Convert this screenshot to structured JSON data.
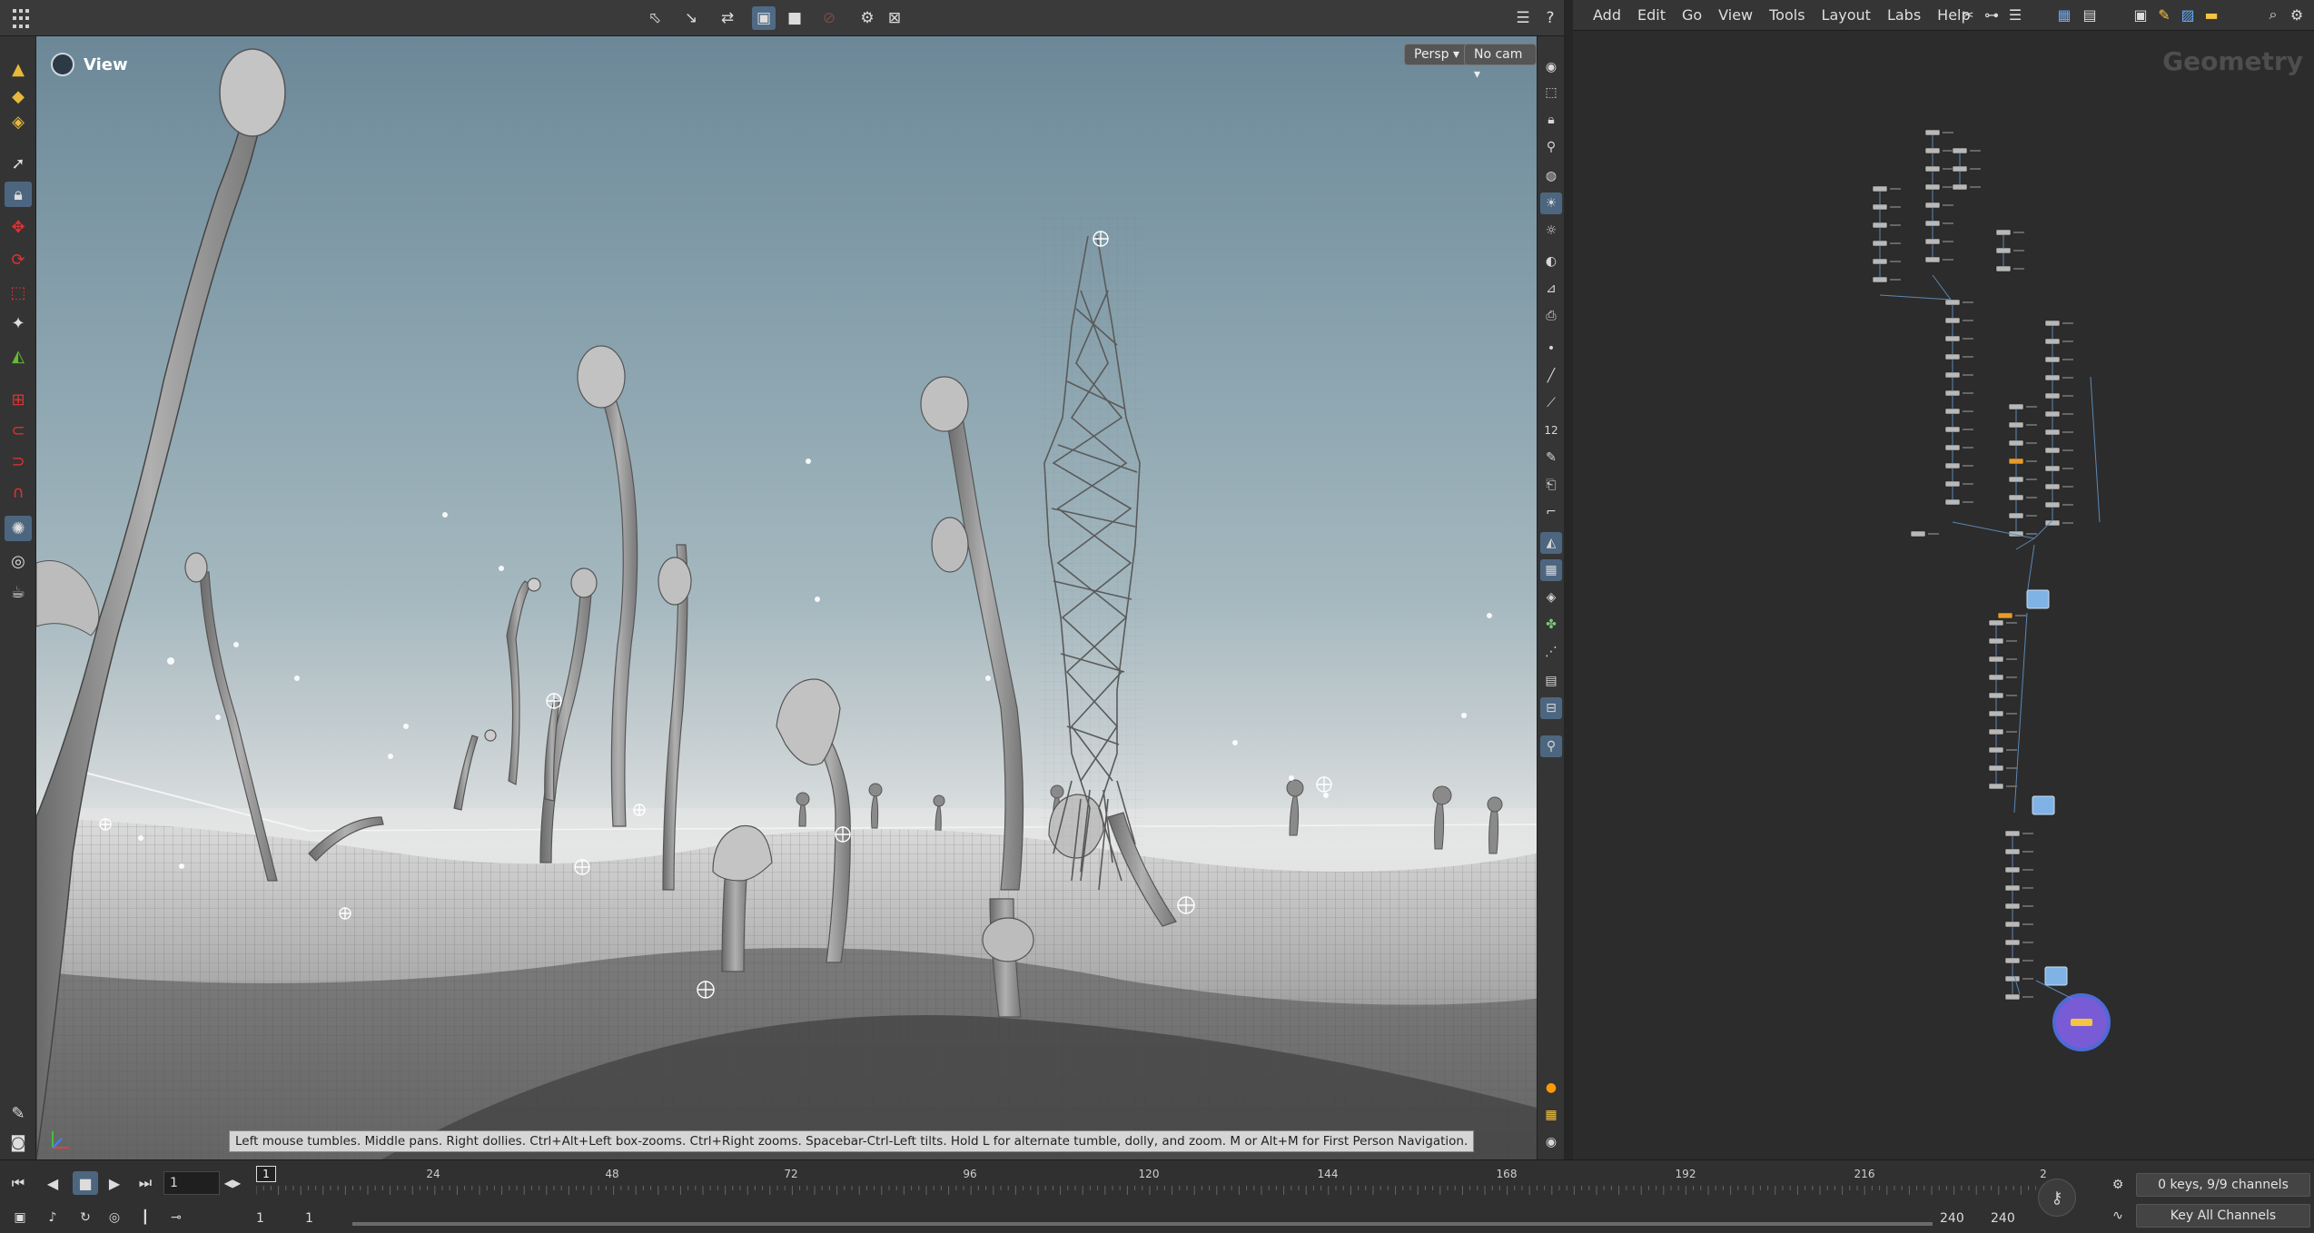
{
  "viewer": {
    "title": "View",
    "persp_label": "Persp ▾",
    "cam_label": "No cam ▾",
    "hint": "Left mouse tumbles. Middle pans. Right dollies. Ctrl+Alt+Left box-zooms. Ctrl+Right zooms. Spacebar-Ctrl-Left tilts. Hold L for alternate tumble, dolly, and zoom. M or Alt+M for First Person Navigation.",
    "snap_number": "12"
  },
  "network": {
    "menus": [
      "Add",
      "Edit",
      "Go",
      "View",
      "Tools",
      "Layout",
      "Labs",
      "Help"
    ],
    "context": "Geometry"
  },
  "timeline": {
    "current_frame": "1",
    "marker": "1",
    "ticks": [
      "24",
      "48",
      "72",
      "96",
      "120",
      "144",
      "168",
      "192",
      "216",
      "2"
    ],
    "start_frame": "1",
    "start_frame2": "1",
    "end_frame": "240",
    "end_frame2": "240",
    "keys_info": "0 keys, 9/9 channels",
    "key_all": "Key All Channels"
  },
  "icons": {
    "apps": "apps-grid-icon",
    "view": "view-camera-icon",
    "play": "play-icon",
    "stop": "stop-icon",
    "help": "help-icon"
  }
}
